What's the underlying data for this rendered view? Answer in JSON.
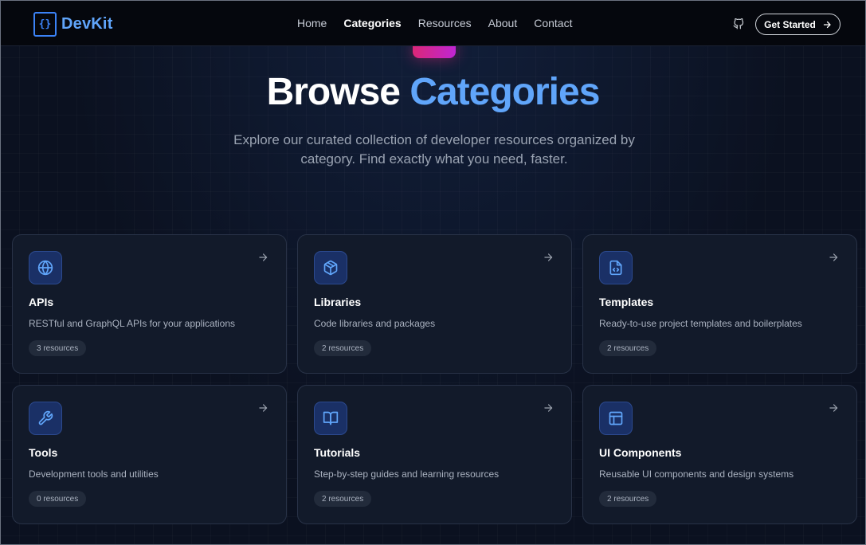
{
  "brand": {
    "logo_glyph": "{}",
    "name": "DevKit"
  },
  "nav": {
    "links": [
      {
        "label": "Home",
        "active": false
      },
      {
        "label": "Categories",
        "active": true
      },
      {
        "label": "Resources",
        "active": false
      },
      {
        "label": "About",
        "active": false
      },
      {
        "label": "Contact",
        "active": false
      }
    ],
    "github_icon": "github-icon",
    "cta_label": "Get Started"
  },
  "hero": {
    "title_main": "Browse",
    "title_accent": "Categories",
    "subtitle": "Explore our curated collection of developer resources organized by category. Find exactly what you need, faster."
  },
  "colors": {
    "accent": "#60a5fa",
    "brand_blue": "#3b82f6",
    "pink": "#db2777",
    "background": "#0b1120",
    "card": "#121a2a"
  },
  "categories": [
    {
      "icon": "globe-icon",
      "title": "APIs",
      "description": "RESTful and GraphQL APIs for your applications",
      "count": "3 resources"
    },
    {
      "icon": "package-icon",
      "title": "Libraries",
      "description": "Code libraries and packages",
      "count": "2 resources"
    },
    {
      "icon": "file-code-icon",
      "title": "Templates",
      "description": "Ready-to-use project templates and boilerplates",
      "count": "2 resources"
    },
    {
      "icon": "wrench-icon",
      "title": "Tools",
      "description": "Development tools and utilities",
      "count": "0 resources"
    },
    {
      "icon": "book-open-icon",
      "title": "Tutorials",
      "description": "Step-by-step guides and learning resources",
      "count": "2 resources"
    },
    {
      "icon": "layout-icon",
      "title": "UI Components",
      "description": "Reusable UI components and design systems",
      "count": "2 resources"
    }
  ]
}
